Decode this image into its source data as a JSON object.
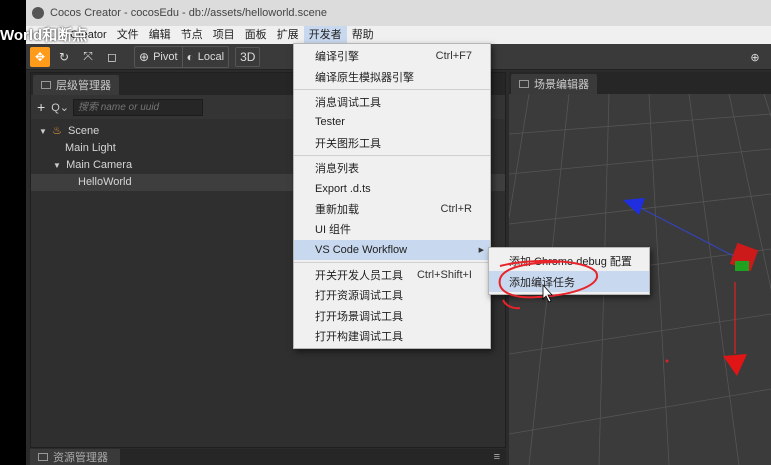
{
  "overlay": {
    "text": "World和断点"
  },
  "window": {
    "title": "Cocos Creator - cocosEdu - db://assets/helloworld.scene"
  },
  "menubar": {
    "items": [
      {
        "label": "Creator"
      },
      {
        "label": "文件"
      },
      {
        "label": "编辑"
      },
      {
        "label": "节点"
      },
      {
        "label": "项目"
      },
      {
        "label": "面板"
      },
      {
        "label": "扩展"
      },
      {
        "label": "开发者"
      },
      {
        "label": "帮助"
      }
    ]
  },
  "toolbar": {
    "pivot_label": "Pivot",
    "local_label": "Local",
    "mode_3d_label": "3D",
    "icons": [
      "move-icon",
      "rotate-icon",
      "scale-icon",
      "rect-icon",
      "pivot-icon",
      "local-globe-icon",
      "globe-icon"
    ]
  },
  "hierarchy": {
    "tab_label": "层级管理器",
    "search_placeholder": "搜索 name or uuid",
    "nodes": [
      {
        "label": "Scene"
      },
      {
        "label": "Main Light"
      },
      {
        "label": "Main Camera"
      },
      {
        "label": "HelloWorld"
      }
    ]
  },
  "assets": {
    "tab_label": "资源管理器"
  },
  "scene_editor": {
    "tab_label": "场景编辑器"
  },
  "developer_menu": {
    "items": [
      {
        "label": "编译引擎",
        "shortcut": "Ctrl+F7"
      },
      {
        "label": "编译原生模拟器引擎",
        "shortcut": ""
      },
      {
        "label": "消息调试工具",
        "shortcut": ""
      },
      {
        "label": "Tester",
        "shortcut": ""
      },
      {
        "label": "开关图形工具",
        "shortcut": ""
      },
      {
        "label": "消息列表",
        "shortcut": ""
      },
      {
        "label": "Export .d.ts",
        "shortcut": ""
      },
      {
        "label": "重新加载",
        "shortcut": "Ctrl+R"
      },
      {
        "label": "UI 组件",
        "shortcut": ""
      },
      {
        "label": "VS Code Workflow",
        "shortcut": ""
      },
      {
        "label": "开关开发人员工具",
        "shortcut": "Ctrl+Shift+I"
      },
      {
        "label": "打开资源调试工具",
        "shortcut": ""
      },
      {
        "label": "打开场景调试工具",
        "shortcut": ""
      },
      {
        "label": "打开构建调试工具",
        "shortcut": ""
      }
    ]
  },
  "vscode_submenu": {
    "items": [
      {
        "label": "添加 Chrome debug 配置"
      },
      {
        "label": "添加编译任务"
      }
    ]
  },
  "colors": {
    "accent": "#ff9b1a",
    "menu_hover": "#c8d8ee",
    "annotation": "#e8242a"
  }
}
